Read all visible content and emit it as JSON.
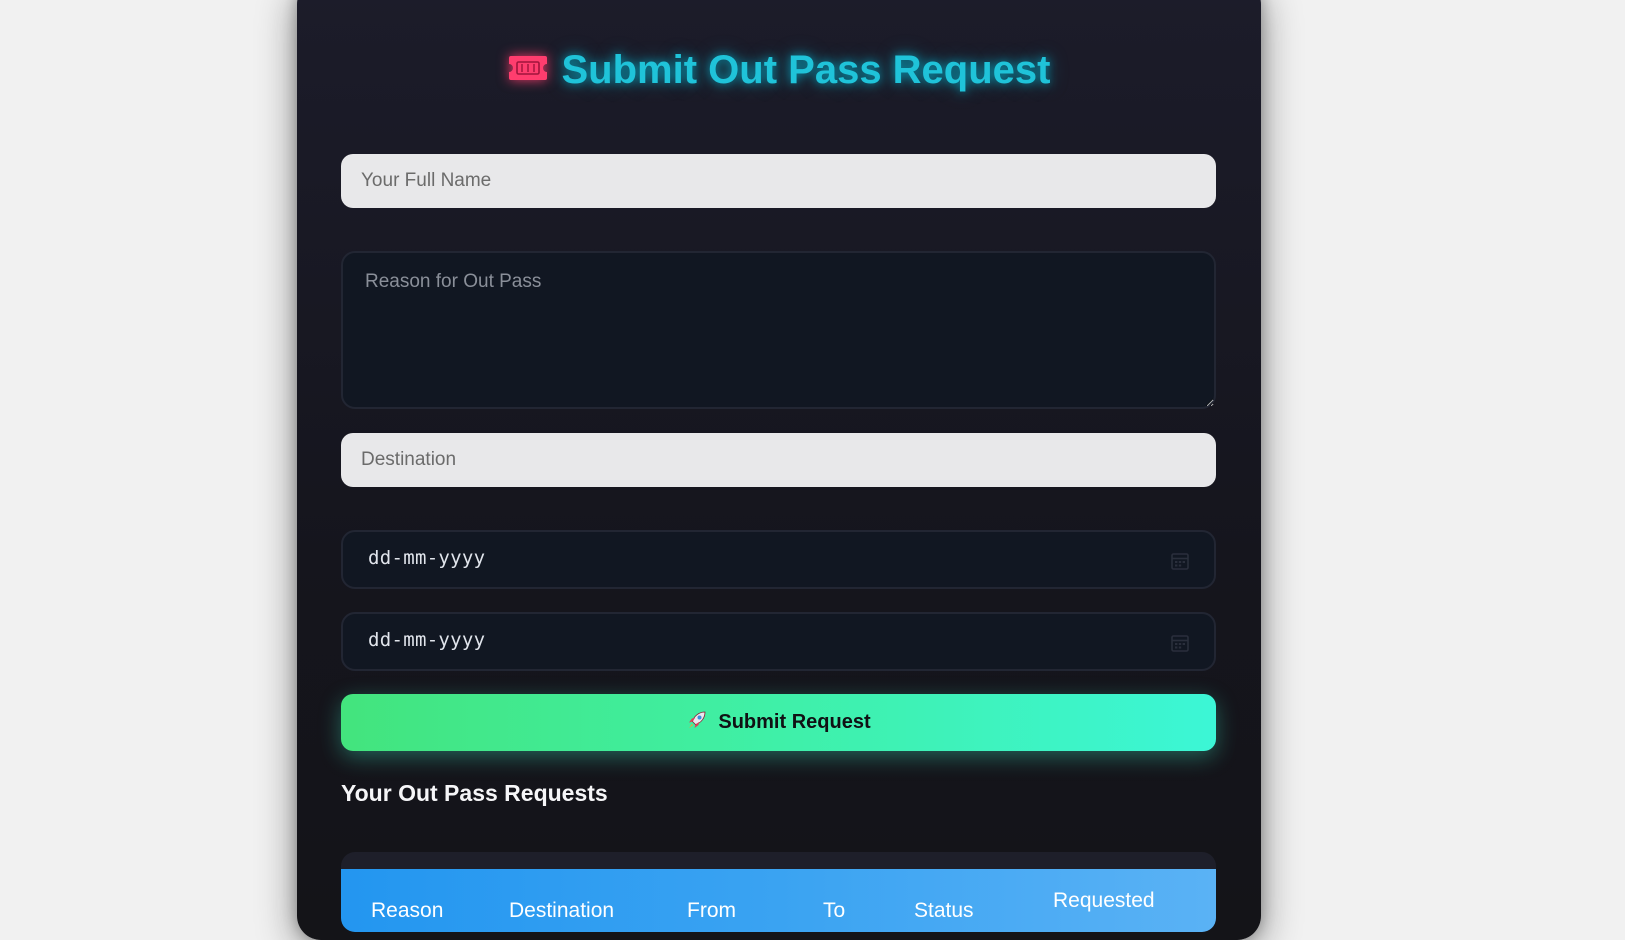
{
  "form": {
    "title": "Submit Out Pass Request",
    "title_icon": "ticket-icon",
    "name_placeholder": "Your Full Name",
    "reason_placeholder": "Reason for Out Pass",
    "destination_placeholder": "Destination",
    "from_date_value": "dd-mm-yyyy",
    "to_date_value": "dd-mm-yyyy",
    "submit_icon": "rocket-icon",
    "submit_label": "Submit Request"
  },
  "requests": {
    "heading": "Your Out Pass Requests",
    "columns": [
      "Reason",
      "Destination",
      "From",
      "To",
      "Status",
      "Requested"
    ]
  },
  "colors": {
    "title": "#1fc3d9",
    "button_start": "#43e47d",
    "button_end": "#3cf6d6",
    "table_header": "#2396f0"
  }
}
